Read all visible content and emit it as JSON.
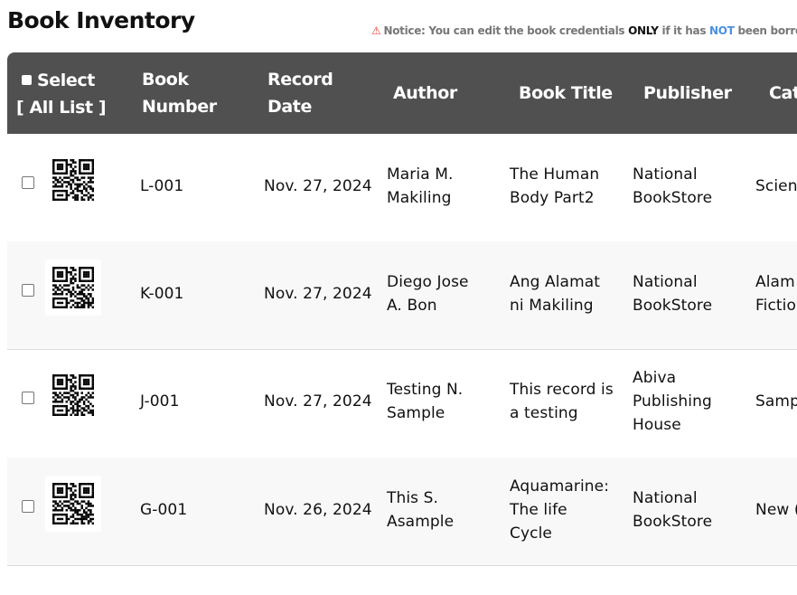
{
  "page": {
    "title": "Book Inventory",
    "notice": {
      "prefix": "Notice: You can edit the book credentials ",
      "only": "ONLY",
      "middle": " if it has ",
      "not": "NOT",
      "suffix": " been borrowe"
    }
  },
  "table": {
    "headers": {
      "select_line1": "Select",
      "select_line2": "[ All List ]",
      "book_number_line1": "Book",
      "book_number_line2": "Number",
      "record_date_line1": "Record",
      "record_date_line2": "Date",
      "author": "Author",
      "book_title": "Book Title",
      "publisher": "Publisher",
      "category": "Cat"
    },
    "rows": [
      {
        "book_number": "L-001",
        "record_date": "Nov. 27, 2024",
        "author": [
          "Maria M.",
          "Makiling"
        ],
        "title": [
          "The Human",
          "Body Part2"
        ],
        "publisher": [
          "National",
          "BookStore"
        ],
        "category": [
          "Scien"
        ]
      },
      {
        "book_number": "K-001",
        "record_date": "Nov. 27, 2024",
        "author": [
          "Diego Jose",
          "A. Bon"
        ],
        "title": [
          "Ang Alamat",
          "ni Makiling"
        ],
        "publisher": [
          "National",
          "BookStore"
        ],
        "category": [
          "Alam",
          "Fictio"
        ]
      },
      {
        "book_number": "J-001",
        "record_date": "Nov. 27, 2024",
        "author": [
          "Testing N.",
          "Sample"
        ],
        "title": [
          "This record is",
          "a testing"
        ],
        "publisher": [
          "Abiva",
          "Publishing",
          "House"
        ],
        "category": [
          "Samp"
        ]
      },
      {
        "book_number": "G-001",
        "record_date": "Nov. 26, 2024",
        "author": [
          "This S.",
          "Asample"
        ],
        "title": [
          "Aquamarine:",
          "The life",
          "Cycle"
        ],
        "publisher": [
          "National",
          "BookStore"
        ],
        "category": [
          "New ("
        ]
      }
    ]
  }
}
